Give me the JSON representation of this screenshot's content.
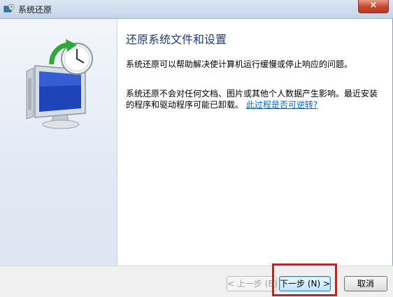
{
  "window": {
    "title": "系统还原",
    "close_label": "×"
  },
  "content": {
    "heading": "还原系统文件和设置",
    "paragraph1": "系统还原可以帮助解决使计算机运行缓慢或停止响应的问题。",
    "paragraph2_text": "系统还原不会对任何文档、图片或其他个人数据产生影响。最近安装的程序和驱动程序可能已卸载。",
    "paragraph2_link": "此过程是否可逆转?"
  },
  "buttons": {
    "back": "< 上一步 (B)",
    "next": "下一步 (N) >",
    "cancel": "取消"
  },
  "colors": {
    "highlight": "#e0141a",
    "heading": "#1f3a78",
    "link": "#0066cc"
  },
  "icons": {
    "app": "system-restore-icon",
    "illustration": "monitor-with-clock-restore-illustration"
  }
}
